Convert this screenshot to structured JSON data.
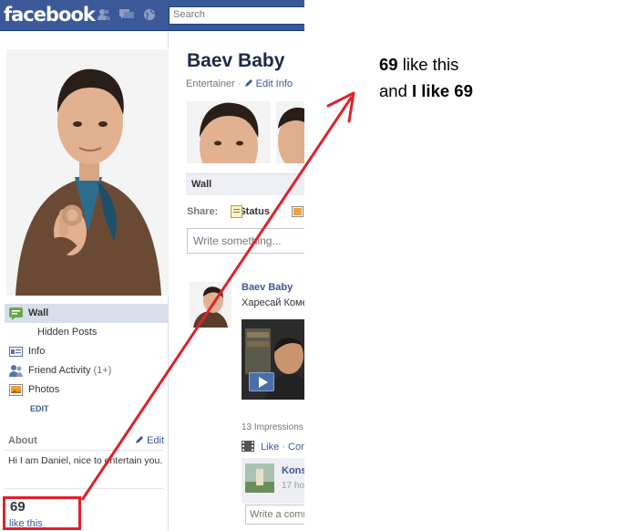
{
  "topbar": {
    "logo": "facebook",
    "search_placeholder": "Search"
  },
  "profile": {
    "name": "Baev Baby",
    "category": "Entertainer",
    "edit_info": "Edit Info"
  },
  "left_nav": {
    "items": [
      {
        "label": "Wall",
        "icon": "wall-icon"
      },
      {
        "label": "Hidden Posts"
      },
      {
        "label": "Info",
        "icon": "info-icon"
      },
      {
        "label": "Friend Activity",
        "count": "(1+)",
        "icon": "friends-icon"
      },
      {
        "label": "Photos",
        "icon": "photos-icon"
      }
    ],
    "edit_label": "EDIT"
  },
  "about": {
    "heading": "About",
    "edit": "Edit",
    "text": "Hi I am Daniel, nice to entertain you."
  },
  "likes": {
    "count": "69",
    "label": "like this"
  },
  "wall": {
    "tab_label": "Wall",
    "share_label": "Share:",
    "status_label": "Status",
    "composer_placeholder": "Write something..."
  },
  "post": {
    "author": "Baev Baby",
    "text": "Харесай Коме",
    "impressions": "13 Impressions",
    "like_action": "Like",
    "comment_action": "Comm",
    "commenter_name": "Kons",
    "commenter_time": "17 ho",
    "write_comment_placeholder": "Write a comm"
  },
  "annotation": {
    "line1_bold": "69",
    "line1_rest": " like this",
    "line2_pre": "and ",
    "line2_bold": "I like 69"
  },
  "colors": {
    "fb_blue": "#3b5998",
    "annotation_red": "#e0202a"
  }
}
